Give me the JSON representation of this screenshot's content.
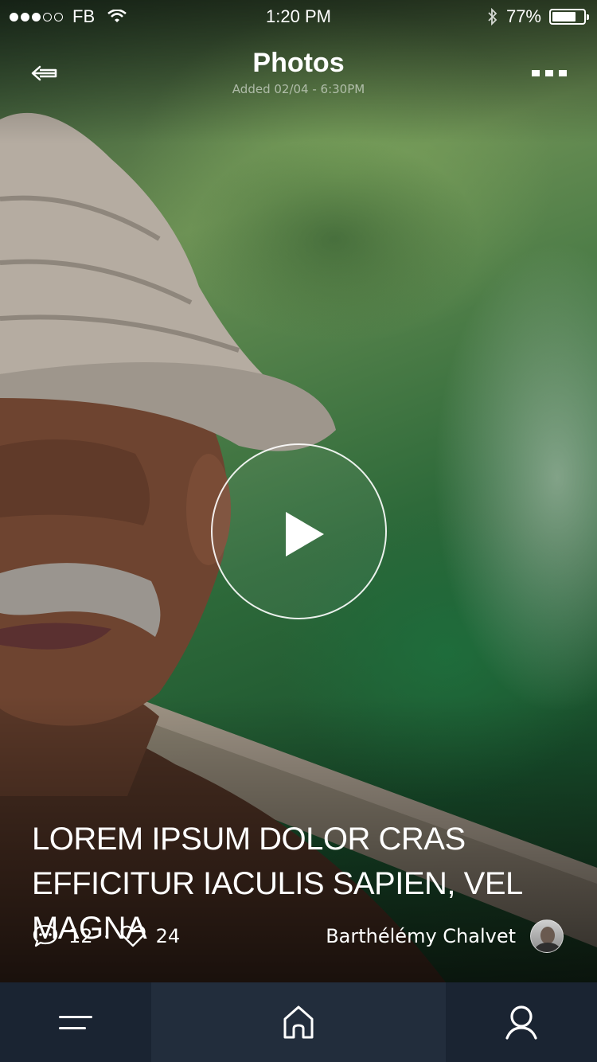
{
  "status_bar": {
    "carrier": "FB",
    "time": "1:20 PM",
    "battery": "77%",
    "battery_level": 0.77,
    "signal_bars_filled": 3,
    "signal_bars_total": 5
  },
  "nav": {
    "title": "Photos",
    "subtitle": "Added 02/04 - 6:30PM",
    "back_icon": "arrow-left-icon",
    "more_icon": "ellipsis-icon"
  },
  "media": {
    "play_icon": "play-icon"
  },
  "article": {
    "headline": "LOREM IPSUM DOLOR CRAS EFFICITUR IACULIS SAPIEN, VEL MAGNA",
    "comments_count": "12",
    "separator": "·",
    "likes_count": "24",
    "author": "Barthélémy Chalvet"
  },
  "tab_bar": {
    "items": [
      {
        "icon": "menu-icon"
      },
      {
        "icon": "home-icon"
      },
      {
        "icon": "search-icon"
      }
    ],
    "background": "#1a2432",
    "active_background": "#222d3c"
  }
}
